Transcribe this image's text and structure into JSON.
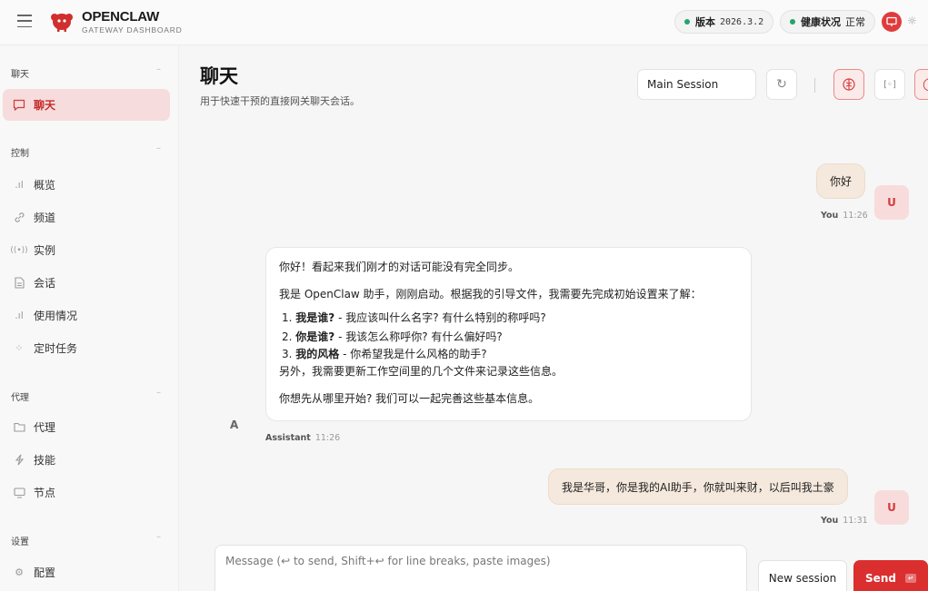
{
  "header": {
    "brand_name": "OPENCLAW",
    "brand_sub": "GATEWAY DASHBOARD",
    "version_label": "版本",
    "version_value": "2026.3.2",
    "health_label": "健康状况",
    "health_value": "正常",
    "accent_color": "#db2f2f",
    "status_color": "#22a56a"
  },
  "sidebar": {
    "sections": [
      {
        "title": "聊天",
        "items": [
          {
            "label": "聊天",
            "icon": "chat-bubble-icon",
            "active": true
          }
        ]
      },
      {
        "title": "控制",
        "items": [
          {
            "label": "概览",
            "icon": "bar-chart-icon"
          },
          {
            "label": "频道",
            "icon": "link-icon"
          },
          {
            "label": "实例",
            "icon": "broadcast-icon"
          },
          {
            "label": "会话",
            "icon": "document-icon"
          },
          {
            "label": "使用情况",
            "icon": "bar-chart-icon"
          },
          {
            "label": "定时任务",
            "icon": "loader-icon"
          }
        ]
      },
      {
        "title": "代理",
        "items": [
          {
            "label": "代理",
            "icon": "folder-icon"
          },
          {
            "label": "技能",
            "icon": "lightning-icon"
          },
          {
            "label": "节点",
            "icon": "monitor-icon"
          }
        ]
      },
      {
        "title": "设置",
        "items": [
          {
            "label": "配置",
            "icon": "gear-icon"
          }
        ]
      }
    ]
  },
  "main": {
    "title": "聊天",
    "subtitle": "用于快速干预的直接网关聊天会话。",
    "session_select": "Main Session"
  },
  "chat": {
    "messages": [
      {
        "role": "user",
        "text": "你好",
        "author": "You",
        "time": "11:26",
        "avatar": "U"
      },
      {
        "role": "assistant",
        "author": "Assistant",
        "time": "11:26",
        "avatar": "A",
        "intro": "你好！看起来我们刚才的对话可能没有完全同步。",
        "para": "我是 OpenClaw 助手，刚刚启动。根据我的引导文件，我需要先完成初始设置来了解：",
        "list": [
          {
            "num": "1.",
            "bold": "我是谁?",
            "rest": " - 我应该叫什么名字? 有什么特别的称呼吗?"
          },
          {
            "num": "2.",
            "bold": "你是谁?",
            "rest": " - 我该怎么称呼你? 有什么偏好吗?"
          },
          {
            "num": "3.",
            "bold": "我的风格",
            "rest": " - 你希望我是什么风格的助手?"
          }
        ],
        "after": "另外，我需要更新工作空间里的几个文件来记录这些信息。",
        "closing": "你想先从哪里开始? 我们可以一起完善这些基本信息。"
      },
      {
        "role": "user",
        "text": "我是华哥，你是我的AI助手，你就叫来财，以后叫我土豪",
        "author": "You",
        "time": "11:31",
        "avatar": "U"
      }
    ]
  },
  "composer": {
    "placeholder": "Message (↩ to send, Shift+↩ for line breaks, paste images)",
    "new_session": "New session",
    "send": "Send"
  }
}
